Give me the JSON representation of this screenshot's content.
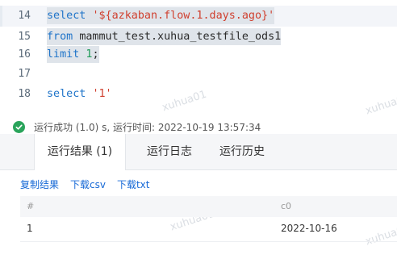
{
  "editor": {
    "lines": [
      {
        "num": "14",
        "segments": [
          "select ",
          "'${azkaban.flow.1.days.ago}'"
        ]
      },
      {
        "num": "15",
        "segments": [
          "from ",
          "mammut_test.xuhua_testfile_ods1"
        ]
      },
      {
        "num": "16",
        "segments": [
          "limit ",
          "1",
          ";"
        ]
      },
      {
        "num": "17",
        "segments": []
      },
      {
        "num": "18",
        "segments": [
          "select ",
          "'1'"
        ]
      }
    ],
    "watermark": "xuhua01"
  },
  "status": {
    "text": "运行成功 (1.0) s, 运行时间: 2022-10-19 13:57:34",
    "color": "#2aa45b",
    "icon": "check-circle-icon"
  },
  "tabs": [
    {
      "label": "运行结果 (1)"
    },
    {
      "label": "运行日志"
    },
    {
      "label": "运行历史"
    }
  ],
  "actions": [
    {
      "label": "复制结果"
    },
    {
      "label": "下载csv"
    },
    {
      "label": "下载txt"
    }
  ],
  "table": {
    "headers": [
      "#",
      "c0"
    ],
    "rows": [
      [
        "1",
        "2022-10-16"
      ]
    ]
  },
  "colors": {
    "link": "#1769d6",
    "keyword": "#1f74c9",
    "string": "#d0402f",
    "number": "#1f9a58"
  }
}
